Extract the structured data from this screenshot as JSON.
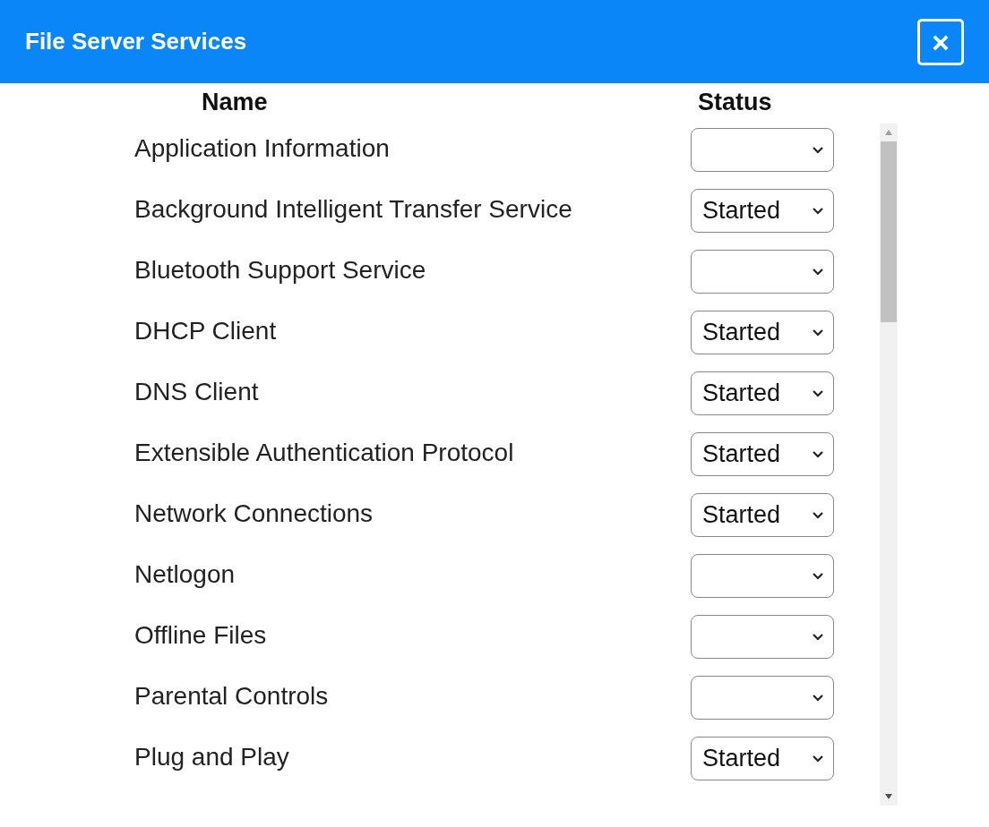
{
  "window": {
    "title": "File Server Services",
    "close": "×"
  },
  "table": {
    "columns": [
      "Name",
      "Status"
    ],
    "rows": [
      {
        "name": "Application Information"
      },
      {
        "name": "Background Intelligent Transfer Service",
        "status": "Started"
      },
      {
        "name": "Bluetooth Support Service"
      },
      {
        "name": "DHCP Client",
        "status": "Started"
      },
      {
        "name": "DNS Client",
        "status": "Started"
      },
      {
        "name": "Extensible Authentication Protocol",
        "status": "Started"
      },
      {
        "name": "Network Connections",
        "status": "Started"
      },
      {
        "name": "Netlogon"
      },
      {
        "name": "Offline Files"
      },
      {
        "name": "Parental Controls"
      },
      {
        "name": "Plug and Play",
        "status": "Started"
      }
    ]
  }
}
